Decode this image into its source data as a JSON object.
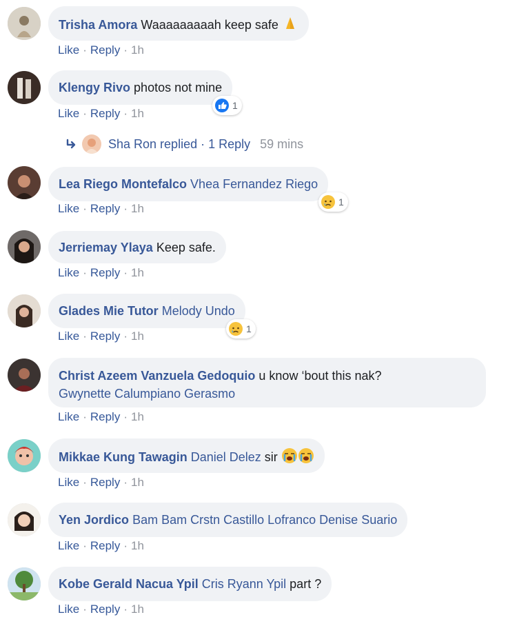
{
  "comments": [
    {
      "name": "Trisha Amora",
      "text": "Waaaaaaaaah keep safe",
      "like": "Like",
      "reply": "Reply",
      "time": "1h"
    },
    {
      "name": "Klengy Rivo",
      "text": "photos not mine",
      "like": "Like",
      "reply": "Reply",
      "time": "1h",
      "reaction_count": "1"
    },
    {
      "name": "Lea Riego Montefalco",
      "tag": "Vhea Fernandez Riego",
      "like": "Like",
      "reply": "Reply",
      "time": "1h",
      "reaction_count": "1"
    },
    {
      "name": "Jerriemay Ylaya",
      "text": "Keep safe.",
      "like": "Like",
      "reply": "Reply",
      "time": "1h"
    },
    {
      "name": "Glades Mie Tutor",
      "tag": "Melody Undo",
      "like": "Like",
      "reply": "Reply",
      "time": "1h",
      "reaction_count": "1"
    },
    {
      "name": "Christ Azeem Vanzuela Gedoquio",
      "text": "u know ‘bout this nak?",
      "tag": "Gwynette Calumpiano Gerasmo",
      "like": "Like",
      "reply": "Reply",
      "time": "1h"
    },
    {
      "name": "Mikkae Kung Tawagin",
      "tag": "Daniel Delez",
      "text": "sir",
      "like": "Like",
      "reply": "Reply",
      "time": "1h"
    },
    {
      "name": "Yen Jordico",
      "tag": "Bam Bam Crstn Castillo Lofranco Denise Suario",
      "like": "Like",
      "reply": "Reply",
      "time": "1h"
    },
    {
      "name": "Kobe Gerald Nacua Ypil",
      "tag": "Cris Ryann Ypil",
      "text": "part ?",
      "like": "Like",
      "reply": "Reply",
      "time": "1h"
    }
  ],
  "reply_summary": {
    "text": "Sha Ron replied · 1 Reply",
    "time": "59 mins"
  },
  "icons": {
    "like_reaction": "thumbs-up-icon",
    "sad_reaction": "sad-face-icon",
    "pray": "praying-hands-icon",
    "crying": "loudly-crying-face-icon",
    "reply_arrow": "reply-arrow-icon"
  },
  "colors": {
    "link": "#385898",
    "bubble": "#f0f2f5",
    "meta": "#90949c",
    "like_blue": "#1877f2"
  }
}
